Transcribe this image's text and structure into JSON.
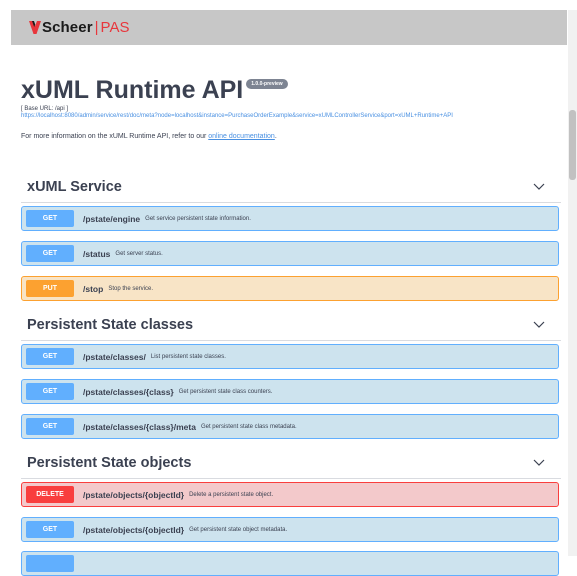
{
  "topbar": {
    "brand": "Scheer",
    "separator": "|",
    "product": "PAS"
  },
  "info": {
    "title": "xUML Runtime API",
    "version": "1.0.0-preview",
    "base_url": "[ Base URL: /api ]",
    "spec_url": "https://localhost:8080/admin/service/rest/doc/meta?node=localhost&instance=PurchaseOrderExample&service=xUMLControllerService&port=xUML+Runtime+API",
    "description_prefix": "For more information on the xUML Runtime API, refer to our ",
    "description_link": "online documentation",
    "description_suffix": "."
  },
  "sections": [
    {
      "title": "xUML Service",
      "operations": [
        {
          "method": "GET",
          "path": "/pstate/engine",
          "summary": "Get service persistent state information."
        },
        {
          "method": "GET",
          "path": "/status",
          "summary": "Get server status."
        },
        {
          "method": "PUT",
          "path": "/stop",
          "summary": "Stop the service."
        }
      ]
    },
    {
      "title": "Persistent State classes",
      "operations": [
        {
          "method": "GET",
          "path": "/pstate/classes/",
          "summary": "List persistent state classes."
        },
        {
          "method": "GET",
          "path": "/pstate/classes/{class}",
          "summary": "Get persistent state class counters."
        },
        {
          "method": "GET",
          "path": "/pstate/classes/{class}/meta",
          "summary": "Get persistent state class metadata."
        }
      ]
    },
    {
      "title": "Persistent State objects",
      "operations": [
        {
          "method": "DELETE",
          "path": "/pstate/objects/{objectId}",
          "summary": "Delete a persistent state object."
        },
        {
          "method": "GET",
          "path": "/pstate/objects/{objectId}",
          "summary": "Get persistent state object metadata."
        }
      ]
    }
  ],
  "colors": {
    "get": "#61affe",
    "put": "#fca130",
    "delete": "#f93e3e",
    "brand_accent": "#e8363c"
  },
  "icons": {
    "logo": "scheer-logo-icon",
    "section_toggle": "chevron-down-icon"
  }
}
